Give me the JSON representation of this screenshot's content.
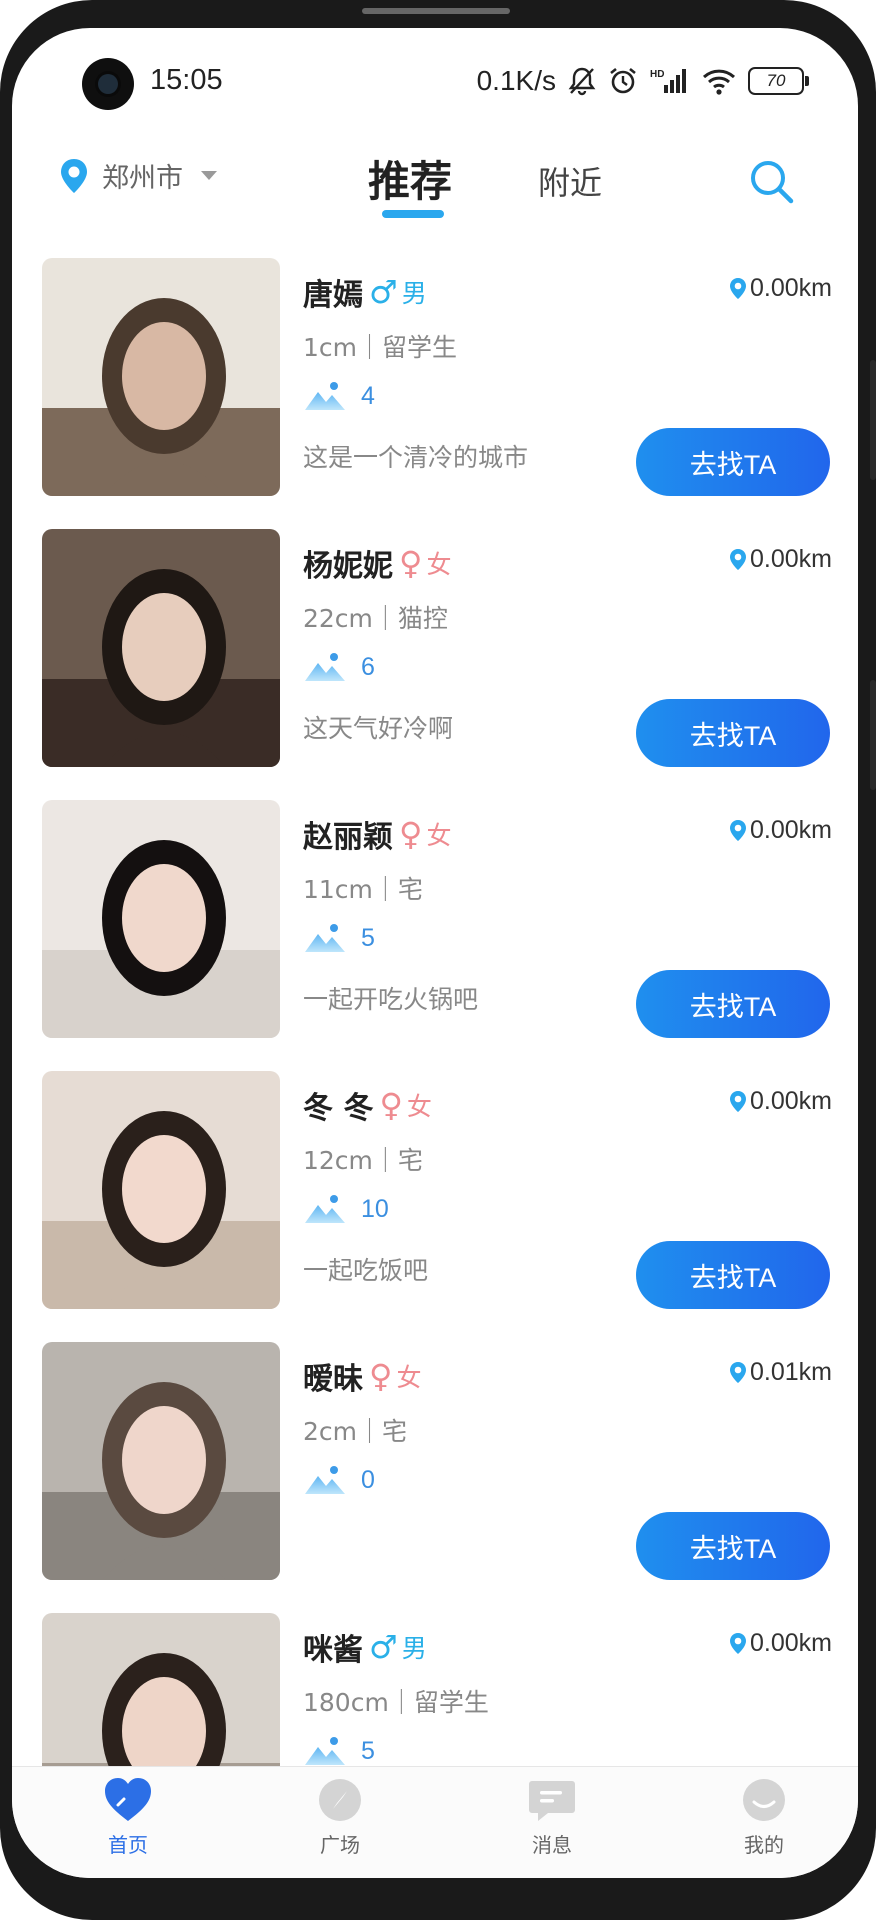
{
  "status_bar": {
    "time": "15:05",
    "net_speed": "0.1K/s",
    "battery": "70",
    "icons": [
      "bell-muted-icon",
      "alarm-icon",
      "hd-signal-icon",
      "wifi-icon",
      "battery-icon"
    ]
  },
  "header": {
    "city": "郑州市",
    "tabs": [
      {
        "label": "推荐",
        "active": true
      },
      {
        "label": "附近",
        "active": false
      }
    ]
  },
  "users": [
    {
      "name": "唐嫣",
      "gender_symbol": "♂",
      "gender": "男",
      "gender_type": "male",
      "distance": "0.00km",
      "meta": "1cm｜留学生",
      "photos": "4",
      "bio": "这是一个清冷的城市",
      "button": "去找TA"
    },
    {
      "name": "杨妮妮",
      "gender_symbol": "♀",
      "gender": "女",
      "gender_type": "female",
      "distance": "0.00km",
      "meta": "22cm｜猫控",
      "photos": "6",
      "bio": "这天气好冷啊",
      "button": "去找TA"
    },
    {
      "name": "赵丽颖",
      "gender_symbol": "♀",
      "gender": "女",
      "gender_type": "female",
      "distance": "0.00km",
      "meta": "11cm｜宅",
      "photos": "5",
      "bio": "一起开吃火锅吧",
      "button": "去找TA"
    },
    {
      "name": "冬 冬",
      "gender_symbol": "♀",
      "gender": "女",
      "gender_type": "female",
      "distance": "0.00km",
      "meta": "12cm｜宅",
      "photos": "10",
      "bio": "一起吃饭吧",
      "button": "去找TA"
    },
    {
      "name": "暧昧",
      "gender_symbol": "♀",
      "gender": "女",
      "gender_type": "female",
      "distance": "0.01km",
      "meta": "2cm｜宅",
      "photos": "0",
      "bio": "",
      "button": "去找TA"
    },
    {
      "name": "咪酱",
      "gender_symbol": "♂",
      "gender": "男",
      "gender_type": "male",
      "distance": "0.00km",
      "meta": "180cm｜留学生",
      "photos": "5",
      "bio": "",
      "button": ""
    }
  ],
  "bottom_nav": [
    {
      "label": "首页",
      "icon": "heart-icon",
      "active": true
    },
    {
      "label": "广场",
      "icon": "compass-icon",
      "active": false
    },
    {
      "label": "消息",
      "icon": "message-icon",
      "active": false
    },
    {
      "label": "我的",
      "icon": "smile-icon",
      "active": false
    }
  ],
  "colors": {
    "accent": "#2aa7ee",
    "button": "#2166ec",
    "male": "#2ab0e8",
    "female": "#ee8b90",
    "photo_count": "#3b8fe0"
  }
}
